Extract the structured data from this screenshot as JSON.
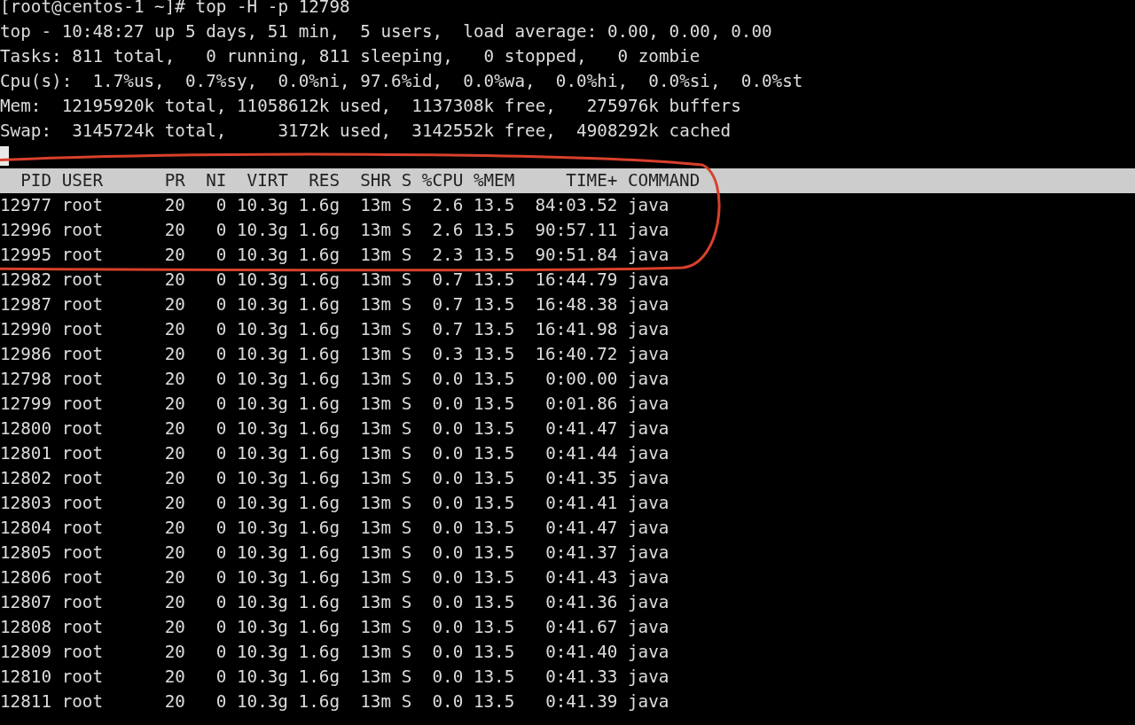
{
  "prompt": "[root@centos-1 ~]# top -H -p 12798",
  "summary_lines": [
    "top - 10:48:27 up 5 days, 51 min,  5 users,  load average: 0.00, 0.00, 0.00",
    "Tasks: 811 total,   0 running, 811 sleeping,   0 stopped,   0 zombie",
    "Cpu(s):  1.7%us,  0.7%sy,  0.0%ni, 97.6%id,  0.0%wa,  0.0%hi,  0.0%si,  0.0%st",
    "Mem:  12195920k total, 11058612k used,  1137308k free,   275976k buffers",
    "Swap:  3145724k total,     3172k used,  3142552k free,  4908292k cached"
  ],
  "table": {
    "columns": [
      "PID",
      "USER",
      "PR",
      "NI",
      "VIRT",
      "RES",
      "SHR",
      "S",
      "%CPU",
      "%MEM",
      "TIME+",
      "COMMAND"
    ],
    "rows": [
      [
        "12977",
        "root",
        "20",
        "0",
        "10.3g",
        "1.6g",
        "13m",
        "S",
        "2.6",
        "13.5",
        "84:03.52",
        "java"
      ],
      [
        "12996",
        "root",
        "20",
        "0",
        "10.3g",
        "1.6g",
        "13m",
        "S",
        "2.6",
        "13.5",
        "90:57.11",
        "java"
      ],
      [
        "12995",
        "root",
        "20",
        "0",
        "10.3g",
        "1.6g",
        "13m",
        "S",
        "2.3",
        "13.5",
        "90:51.84",
        "java"
      ],
      [
        "12982",
        "root",
        "20",
        "0",
        "10.3g",
        "1.6g",
        "13m",
        "S",
        "0.7",
        "13.5",
        "16:44.79",
        "java"
      ],
      [
        "12987",
        "root",
        "20",
        "0",
        "10.3g",
        "1.6g",
        "13m",
        "S",
        "0.7",
        "13.5",
        "16:48.38",
        "java"
      ],
      [
        "12990",
        "root",
        "20",
        "0",
        "10.3g",
        "1.6g",
        "13m",
        "S",
        "0.7",
        "13.5",
        "16:41.98",
        "java"
      ],
      [
        "12986",
        "root",
        "20",
        "0",
        "10.3g",
        "1.6g",
        "13m",
        "S",
        "0.3",
        "13.5",
        "16:40.72",
        "java"
      ],
      [
        "12798",
        "root",
        "20",
        "0",
        "10.3g",
        "1.6g",
        "13m",
        "S",
        "0.0",
        "13.5",
        "0:00.00",
        "java"
      ],
      [
        "12799",
        "root",
        "20",
        "0",
        "10.3g",
        "1.6g",
        "13m",
        "S",
        "0.0",
        "13.5",
        "0:01.86",
        "java"
      ],
      [
        "12800",
        "root",
        "20",
        "0",
        "10.3g",
        "1.6g",
        "13m",
        "S",
        "0.0",
        "13.5",
        "0:41.47",
        "java"
      ],
      [
        "12801",
        "root",
        "20",
        "0",
        "10.3g",
        "1.6g",
        "13m",
        "S",
        "0.0",
        "13.5",
        "0:41.44",
        "java"
      ],
      [
        "12802",
        "root",
        "20",
        "0",
        "10.3g",
        "1.6g",
        "13m",
        "S",
        "0.0",
        "13.5",
        "0:41.35",
        "java"
      ],
      [
        "12803",
        "root",
        "20",
        "0",
        "10.3g",
        "1.6g",
        "13m",
        "S",
        "0.0",
        "13.5",
        "0:41.41",
        "java"
      ],
      [
        "12804",
        "root",
        "20",
        "0",
        "10.3g",
        "1.6g",
        "13m",
        "S",
        "0.0",
        "13.5",
        "0:41.47",
        "java"
      ],
      [
        "12805",
        "root",
        "20",
        "0",
        "10.3g",
        "1.6g",
        "13m",
        "S",
        "0.0",
        "13.5",
        "0:41.37",
        "java"
      ],
      [
        "12806",
        "root",
        "20",
        "0",
        "10.3g",
        "1.6g",
        "13m",
        "S",
        "0.0",
        "13.5",
        "0:41.43",
        "java"
      ],
      [
        "12807",
        "root",
        "20",
        "0",
        "10.3g",
        "1.6g",
        "13m",
        "S",
        "0.0",
        "13.5",
        "0:41.36",
        "java"
      ],
      [
        "12808",
        "root",
        "20",
        "0",
        "10.3g",
        "1.6g",
        "13m",
        "S",
        "0.0",
        "13.5",
        "0:41.67",
        "java"
      ],
      [
        "12809",
        "root",
        "20",
        "0",
        "10.3g",
        "1.6g",
        "13m",
        "S",
        "0.0",
        "13.5",
        "0:41.40",
        "java"
      ],
      [
        "12810",
        "root",
        "20",
        "0",
        "10.3g",
        "1.6g",
        "13m",
        "S",
        "0.0",
        "13.5",
        "0:41.33",
        "java"
      ],
      [
        "12811",
        "root",
        "20",
        "0",
        "10.3g",
        "1.6g",
        "13m",
        "S",
        "0.0",
        "13.5",
        "0:41.39",
        "java"
      ]
    ]
  }
}
